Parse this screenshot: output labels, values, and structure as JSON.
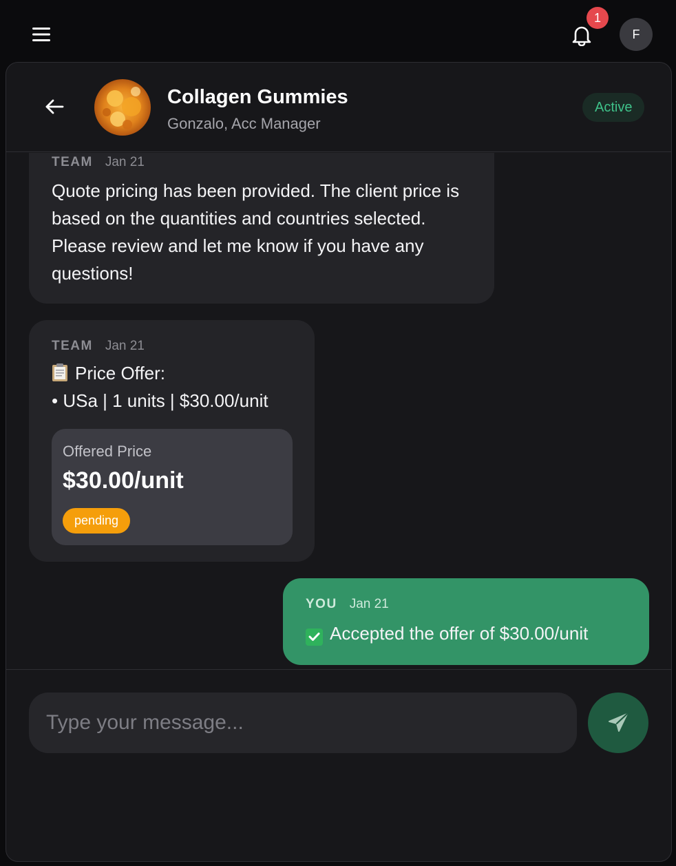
{
  "topbar": {
    "notification_count": "1",
    "user_initial": "F"
  },
  "chat": {
    "title": "Collagen Gummies",
    "subtitle": "Gonzalo, Acc Manager",
    "status": "Active",
    "status_color": "#3fc28a"
  },
  "messages": [
    {
      "sender": "TEAM",
      "date": "Jan 21",
      "text": "Quote pricing has been provided. The client price is based on the quantities and countries selected. Please review and let me know if you have any questions!"
    },
    {
      "sender": "TEAM",
      "date": "Jan 21",
      "heading": "Price Offer:",
      "line": "• USa | 1 units | $30.00/unit",
      "offer_label": "Offered Price",
      "offer_price": "$30.00/unit",
      "offer_status": "pending"
    },
    {
      "sender": "YOU",
      "date": "Jan 21",
      "text": "Accepted the offer of $30.00/unit"
    }
  ],
  "composer": {
    "placeholder": "Type your message..."
  },
  "colors": {
    "accent_green": "#339467",
    "pending": "#f59e0b",
    "badge_red": "#e5484d"
  }
}
